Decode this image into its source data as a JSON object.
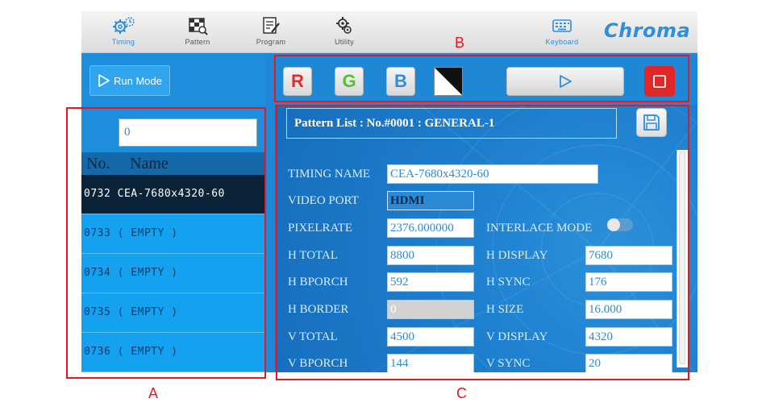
{
  "toolbar": {
    "items": [
      {
        "label": "Timing",
        "icon": "timing-gear-icon",
        "active": true
      },
      {
        "label": "Pattern",
        "icon": "pattern-icon",
        "active": false
      },
      {
        "label": "Program",
        "icon": "program-icon",
        "active": false
      },
      {
        "label": "Utility",
        "icon": "utility-gear-icon",
        "active": false
      },
      {
        "label": "Keyboard",
        "icon": "keyboard-icon",
        "active": false
      }
    ],
    "brand": "Chroma"
  },
  "left_panel": {
    "run_mode_label": "Run Mode",
    "search_value": "0",
    "table_headers": {
      "no": "No.",
      "name": "Name"
    },
    "rows": [
      {
        "text": "0732 CEA-7680x4320-60",
        "selected": true
      },
      {
        "text": "0733 ( EMPTY )",
        "selected": false
      },
      {
        "text": "0734 ( EMPTY )",
        "selected": false
      },
      {
        "text": "0735 ( EMPTY )",
        "selected": false
      },
      {
        "text": "0736 ( EMPTY )",
        "selected": false
      }
    ]
  },
  "action_bar": {
    "r_label": "R",
    "g_label": "G",
    "b_label": "B",
    "bw_icon": "black-white-pattern-icon",
    "play_icon": "play-icon",
    "stop_icon": "stop-icon"
  },
  "main": {
    "pattern_list_title": "Pattern List : No.#0001 : GENERAL-1",
    "fields": {
      "timing_name": {
        "label": "TIMING NAME",
        "value": "CEA-7680x4320-60"
      },
      "video_port": {
        "label": "VIDEO PORT",
        "value": "HDMI"
      },
      "pixelrate": {
        "label": "PIXELRATE",
        "value": "2376.000000"
      },
      "interlace_mode": {
        "label": "INTERLACE MODE",
        "on": false
      },
      "h_total": {
        "label": "H TOTAL",
        "value": "8800"
      },
      "h_display": {
        "label": "H DISPLAY",
        "value": "7680"
      },
      "h_bporch": {
        "label": "H BPORCH",
        "value": "592"
      },
      "h_sync": {
        "label": "H SYNC",
        "value": "176"
      },
      "h_border": {
        "label": "H BORDER",
        "value": "0"
      },
      "h_size": {
        "label": "H SIZE",
        "value": "16.000"
      },
      "v_total": {
        "label": "V TOTAL",
        "value": "4500"
      },
      "v_display": {
        "label": "V DISPLAY",
        "value": "4320"
      },
      "v_bporch": {
        "label": "V BPORCH",
        "value": "144"
      },
      "v_sync": {
        "label": "V SYNC",
        "value": "20"
      }
    }
  },
  "annotations": {
    "a": "A",
    "b": "B",
    "c": "C",
    "color": "#e8171e"
  },
  "colors": {
    "accent": "#2b8de0",
    "panel": "#1e88d6",
    "selected_row": "#0b2338",
    "stop": "#e02626"
  }
}
